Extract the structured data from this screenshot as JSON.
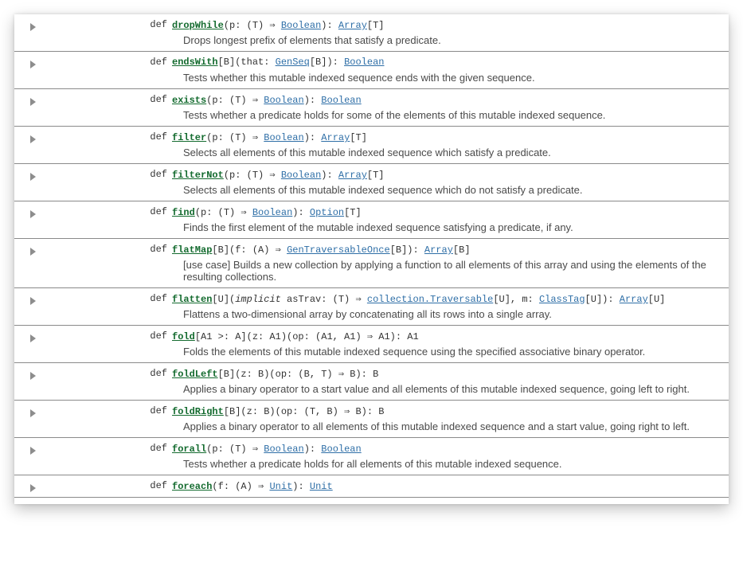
{
  "kind_label": "def",
  "members": [
    {
      "name": "dropWhile",
      "sig": [
        {
          "t": "name",
          "v": "dropWhile"
        },
        {
          "t": "txt",
          "v": "(p: (T) ⇒ "
        },
        {
          "t": "link",
          "v": "Boolean"
        },
        {
          "t": "txt",
          "v": "): "
        },
        {
          "t": "link",
          "v": "Array"
        },
        {
          "t": "txt",
          "v": "[T]"
        }
      ],
      "desc": "Drops longest prefix of elements that satisfy a predicate."
    },
    {
      "name": "endsWith",
      "sig": [
        {
          "t": "name",
          "v": "endsWith"
        },
        {
          "t": "txt",
          "v": "[B](that: "
        },
        {
          "t": "link",
          "v": "GenSeq"
        },
        {
          "t": "txt",
          "v": "[B]): "
        },
        {
          "t": "link",
          "v": "Boolean"
        }
      ],
      "desc": "Tests whether this mutable indexed sequence ends with the given sequence."
    },
    {
      "name": "exists",
      "sig": [
        {
          "t": "name",
          "v": "exists"
        },
        {
          "t": "txt",
          "v": "(p: (T) ⇒ "
        },
        {
          "t": "link",
          "v": "Boolean"
        },
        {
          "t": "txt",
          "v": "): "
        },
        {
          "t": "link",
          "v": "Boolean"
        }
      ],
      "desc": "Tests whether a predicate holds for some of the elements of this mutable indexed sequence."
    },
    {
      "name": "filter",
      "sig": [
        {
          "t": "name",
          "v": "filter"
        },
        {
          "t": "txt",
          "v": "(p: (T) ⇒ "
        },
        {
          "t": "link",
          "v": "Boolean"
        },
        {
          "t": "txt",
          "v": "): "
        },
        {
          "t": "link",
          "v": "Array"
        },
        {
          "t": "txt",
          "v": "[T]"
        }
      ],
      "desc": "Selects all elements of this mutable indexed sequence which satisfy a predicate."
    },
    {
      "name": "filterNot",
      "sig": [
        {
          "t": "name",
          "v": "filterNot"
        },
        {
          "t": "txt",
          "v": "(p: (T) ⇒ "
        },
        {
          "t": "link",
          "v": "Boolean"
        },
        {
          "t": "txt",
          "v": "): "
        },
        {
          "t": "link",
          "v": "Array"
        },
        {
          "t": "txt",
          "v": "[T]"
        }
      ],
      "desc": "Selects all elements of this mutable indexed sequence which do not satisfy a predicate."
    },
    {
      "name": "find",
      "sig": [
        {
          "t": "name",
          "v": "find"
        },
        {
          "t": "txt",
          "v": "(p: (T) ⇒ "
        },
        {
          "t": "link",
          "v": "Boolean"
        },
        {
          "t": "txt",
          "v": "): "
        },
        {
          "t": "link",
          "v": "Option"
        },
        {
          "t": "txt",
          "v": "[T]"
        }
      ],
      "desc": "Finds the first element of the mutable indexed sequence satisfying a predicate, if any."
    },
    {
      "name": "flatMap",
      "sig": [
        {
          "t": "name",
          "v": "flatMap"
        },
        {
          "t": "txt",
          "v": "[B](f: (A) ⇒ "
        },
        {
          "t": "link",
          "v": "GenTraversableOnce"
        },
        {
          "t": "txt",
          "v": "[B]): "
        },
        {
          "t": "link",
          "v": "Array"
        },
        {
          "t": "txt",
          "v": "[B]"
        }
      ],
      "desc": "[use case] Builds a new collection by applying a function to all elements of this array and using the elements of the resulting collections."
    },
    {
      "name": "flatten",
      "sig": [
        {
          "t": "name",
          "v": "flatten"
        },
        {
          "t": "txt",
          "v": "[U]("
        },
        {
          "t": "it",
          "v": "implicit"
        },
        {
          "t": "txt",
          "v": " asTrav: (T) ⇒ "
        },
        {
          "t": "link",
          "v": "collection.Traversable"
        },
        {
          "t": "txt",
          "v": "[U], m: "
        },
        {
          "t": "link",
          "v": "ClassTag"
        },
        {
          "t": "txt",
          "v": "[U]): "
        },
        {
          "t": "link",
          "v": "Array"
        },
        {
          "t": "txt",
          "v": "[U]"
        }
      ],
      "desc": "Flattens a two-dimensional array by concatenating all its rows into a single array."
    },
    {
      "name": "fold",
      "sig": [
        {
          "t": "name",
          "v": "fold"
        },
        {
          "t": "txt",
          "v": "[A1 >: A](z: A1)(op: (A1, A1) ⇒ A1): A1"
        }
      ],
      "desc": "Folds the elements of this mutable indexed sequence using the specified associative binary operator."
    },
    {
      "name": "foldLeft",
      "sig": [
        {
          "t": "name",
          "v": "foldLeft"
        },
        {
          "t": "txt",
          "v": "[B](z: B)(op: (B, T) ⇒ B): B"
        }
      ],
      "desc": "Applies a binary operator to a start value and all elements of this mutable indexed sequence, going left to right."
    },
    {
      "name": "foldRight",
      "sig": [
        {
          "t": "name",
          "v": "foldRight"
        },
        {
          "t": "txt",
          "v": "[B](z: B)(op: (T, B) ⇒ B): B"
        }
      ],
      "desc": "Applies a binary operator to all elements of this mutable indexed sequence and a start value, going right to left."
    },
    {
      "name": "forall",
      "sig": [
        {
          "t": "name",
          "v": "forall"
        },
        {
          "t": "txt",
          "v": "(p: (T) ⇒ "
        },
        {
          "t": "link",
          "v": "Boolean"
        },
        {
          "t": "txt",
          "v": "): "
        },
        {
          "t": "link",
          "v": "Boolean"
        }
      ],
      "desc": "Tests whether a predicate holds for all elements of this mutable indexed sequence."
    },
    {
      "name": "foreach",
      "sig": [
        {
          "t": "name",
          "v": "foreach"
        },
        {
          "t": "txt",
          "v": "(f: (A) ⇒ "
        },
        {
          "t": "link",
          "v": "Unit"
        },
        {
          "t": "txt",
          "v": "): "
        },
        {
          "t": "link",
          "v": "Unit"
        }
      ],
      "desc": ""
    }
  ]
}
